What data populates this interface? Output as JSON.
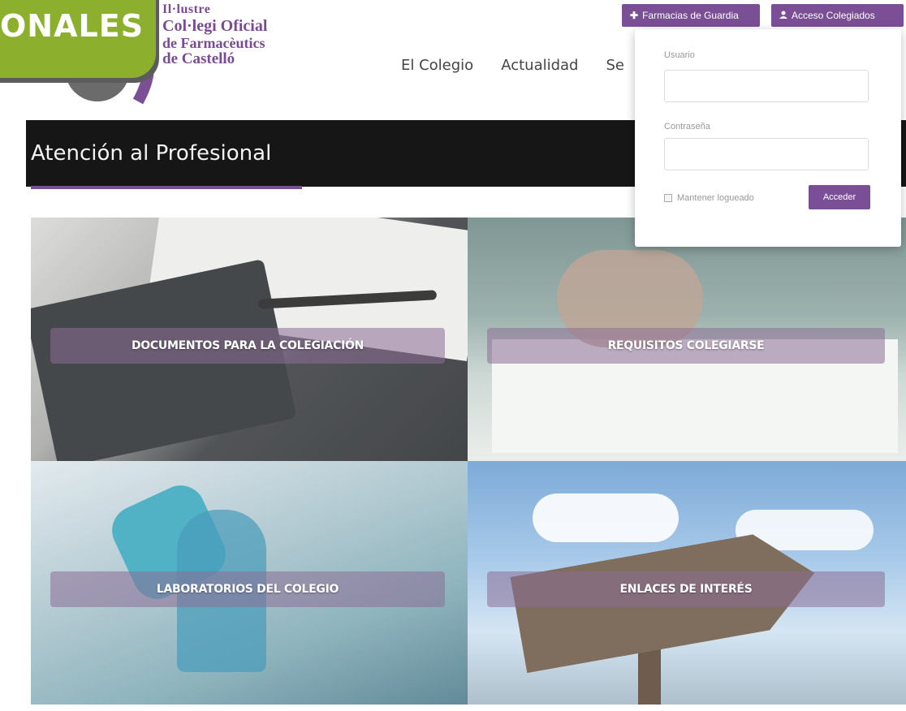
{
  "header": {
    "badge_text": "ONALES",
    "logo": {
      "line1": "Il·lustre",
      "line2": "Col·legi Oficial",
      "line3": "de Farmacèutics",
      "line4": "de Castelló"
    },
    "nav": [
      "El Colegio",
      "Actualidad",
      "Se"
    ],
    "buttons": {
      "guard": "Farmacias de Guardia",
      "access": "Acceso Colegiados"
    }
  },
  "banner": {
    "title": "Atención al Profesional"
  },
  "tiles": [
    {
      "label": "DOCUMENTOS PARA LA COLEGIACIÓN"
    },
    {
      "label": "REQUISITOS COLEGIARSE"
    },
    {
      "label": "LABORATORIOS DEL COLEGIO"
    },
    {
      "label": "ENLACES DE INTERÉS"
    }
  ],
  "login": {
    "user_label": "Usuario",
    "user_value": "",
    "pass_label": "Contraseña",
    "pass_value": "",
    "keep_label": "Mantener logueado",
    "submit_label": "Acceder"
  },
  "colors": {
    "accent": "#7b4f96",
    "badge_green": "#8cb02e",
    "banner_bg": "#161616"
  },
  "icons": {
    "guard": "plus-icon",
    "access": "user-icon"
  }
}
